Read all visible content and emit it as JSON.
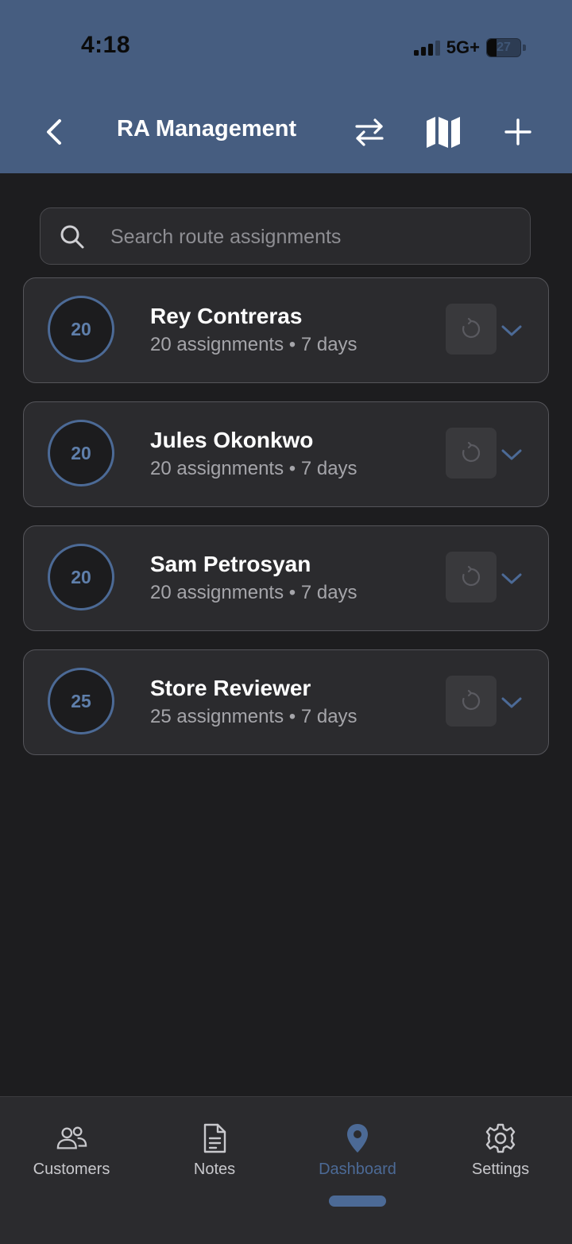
{
  "status_bar": {
    "time": "4:18",
    "network": "5G+",
    "battery": "27"
  },
  "header": {
    "title": "RA Management"
  },
  "search": {
    "placeholder": "Search route assignments",
    "value": ""
  },
  "cards": [
    {
      "count": "20",
      "name": "Rey Contreras",
      "meta": "20 assignments • 7 days"
    },
    {
      "count": "20",
      "name": "Jules Okonkwo",
      "meta": "20 assignments • 7 days"
    },
    {
      "count": "20",
      "name": "Sam Petrosyan",
      "meta": "20 assignments • 7 days"
    },
    {
      "count": "25",
      "name": "Store Reviewer",
      "meta": "25 assignments • 7 days"
    }
  ],
  "tabs": [
    {
      "label": "Customers",
      "icon": "users-icon"
    },
    {
      "label": "Notes",
      "icon": "document-icon"
    },
    {
      "label": "Dashboard",
      "icon": "map-pin-icon",
      "active": true
    },
    {
      "label": "Settings",
      "icon": "gear-icon"
    }
  ],
  "colors": {
    "header": "#465d80",
    "accent": "#4c6a96",
    "background": "#1d1d1f",
    "card": "#2b2b2e"
  }
}
